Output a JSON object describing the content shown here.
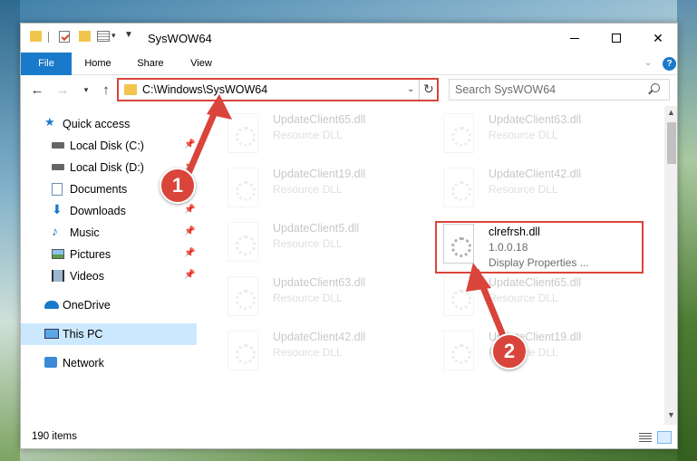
{
  "window": {
    "title": "SysWOW64"
  },
  "ribbon": {
    "tabs": [
      "File",
      "Home",
      "Share",
      "View"
    ]
  },
  "address": {
    "path": "C:\\Windows\\SysWOW64"
  },
  "search": {
    "placeholder": "Search SysWOW64"
  },
  "sidebar": {
    "items": [
      {
        "label": "Quick access",
        "icon": "star-icon"
      },
      {
        "label": "Local Disk (C:)",
        "icon": "drive-icon"
      },
      {
        "label": "Local Disk (D:)",
        "icon": "drive-icon"
      },
      {
        "label": "Documents",
        "icon": "documents-icon"
      },
      {
        "label": "Downloads",
        "icon": "download-icon"
      },
      {
        "label": "Music",
        "icon": "music-icon"
      },
      {
        "label": "Pictures",
        "icon": "pictures-icon"
      },
      {
        "label": "Videos",
        "icon": "videos-icon"
      },
      {
        "label": "OneDrive",
        "icon": "cloud-icon"
      },
      {
        "label": "This PC",
        "icon": "computer-icon"
      },
      {
        "label": "Network",
        "icon": "network-icon"
      }
    ]
  },
  "files": {
    "faded": [
      {
        "name": "UpdateClient65.dll",
        "desc": "Resource DLL"
      },
      {
        "name": "UpdateClient63.dll",
        "desc": "Resource DLL"
      },
      {
        "name": "UpdateClient19.dll",
        "desc": "Resource DLL"
      },
      {
        "name": "UpdateClient42.dll",
        "desc": "Resource DLL"
      },
      {
        "name": "UpdateClient5.dll",
        "desc": "Resource DLL"
      },
      {
        "name": "UpdateClient63.dll",
        "desc": "Resource DLL"
      },
      {
        "name": "UpdateClient65.dll",
        "desc": "Resource DLL"
      },
      {
        "name": "UpdateClient42.dll",
        "desc": "Resource DLL"
      },
      {
        "name": "UpdateClient19.dll",
        "desc": "Resource DLL"
      }
    ],
    "highlighted": {
      "name": "clrefrsh.dll",
      "version": "1.0.0.18",
      "desc": "Display Properties ..."
    }
  },
  "status": {
    "items": "190 items"
  },
  "callouts": [
    "1",
    "2"
  ],
  "colors": {
    "accent": "#1979ca",
    "highlight": "#d9443b",
    "selected": "#cce8ff"
  }
}
